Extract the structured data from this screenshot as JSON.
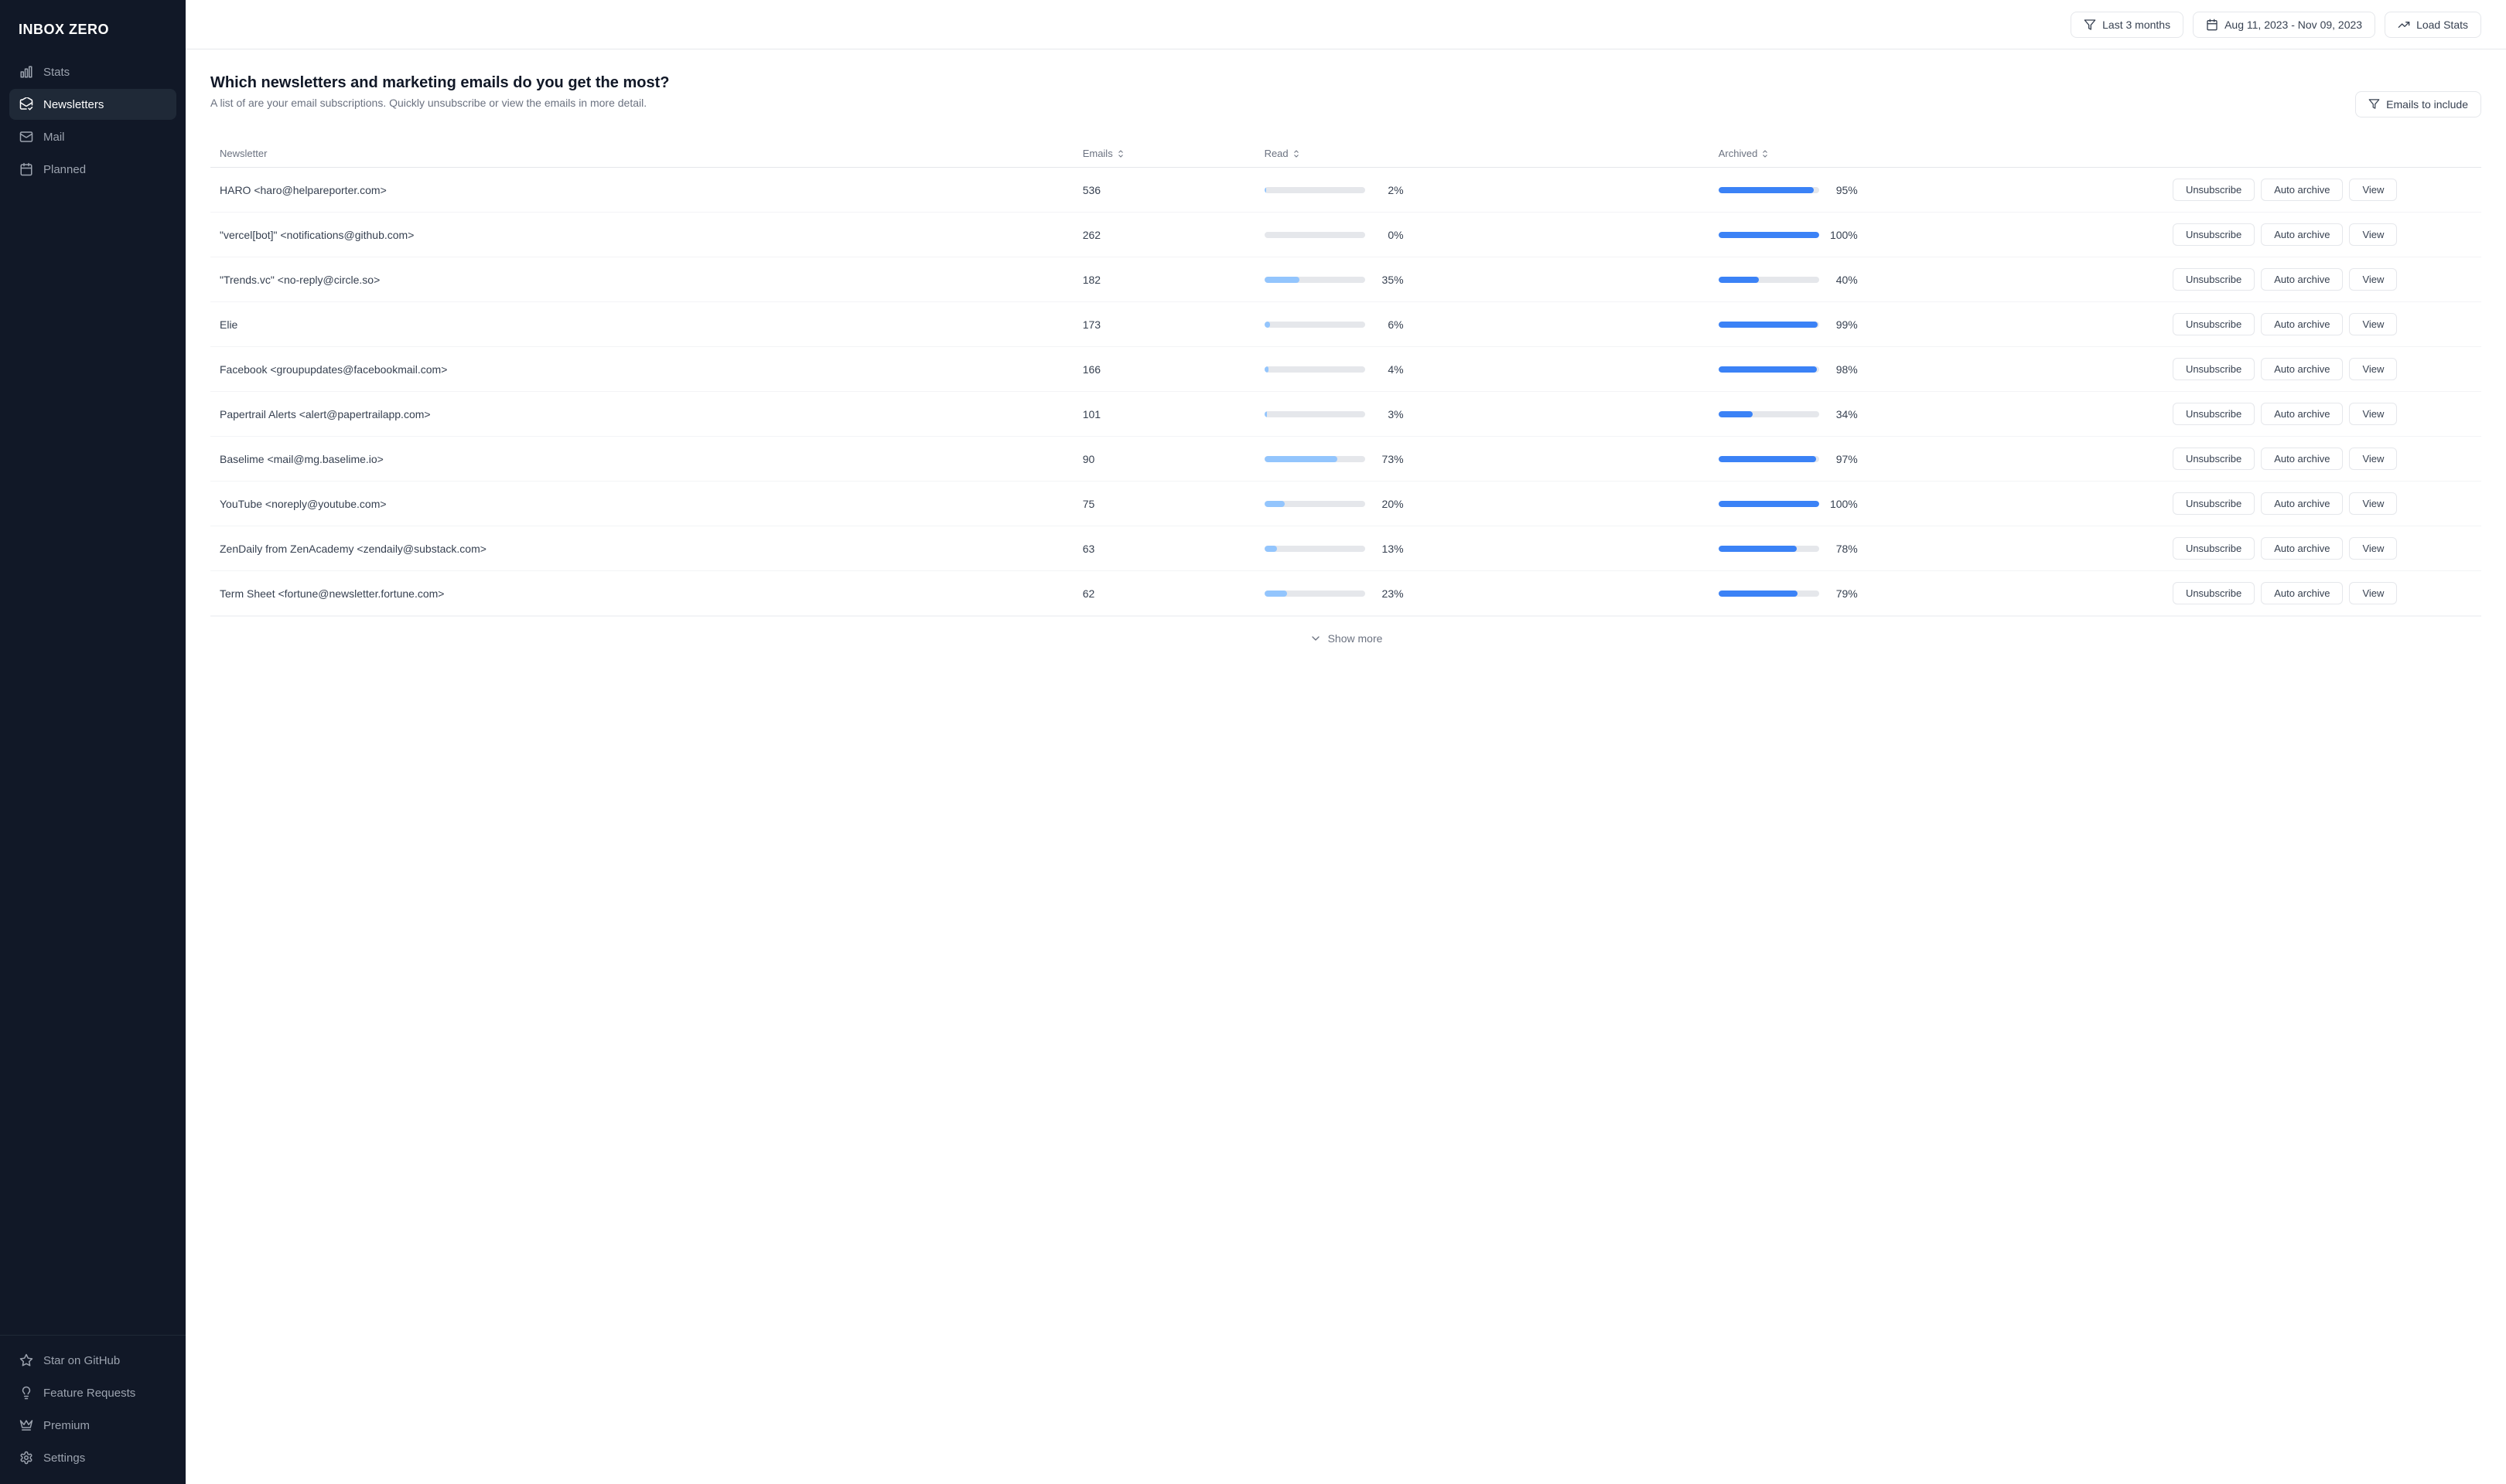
{
  "sidebar": {
    "logo": "INBOX ZERO",
    "items": [
      {
        "id": "stats",
        "label": "Stats",
        "icon": "bar-chart"
      },
      {
        "id": "newsletters",
        "label": "Newsletters",
        "icon": "mail-open",
        "active": true
      },
      {
        "id": "mail",
        "label": "Mail",
        "icon": "mail"
      },
      {
        "id": "planned",
        "label": "Planned",
        "icon": "calendar"
      }
    ],
    "bottom_items": [
      {
        "id": "star-github",
        "label": "Star on GitHub",
        "icon": "star"
      },
      {
        "id": "feature-requests",
        "label": "Feature Requests",
        "icon": "lightbulb"
      },
      {
        "id": "premium",
        "label": "Premium",
        "icon": "crown"
      },
      {
        "id": "settings",
        "label": "Settings",
        "icon": "gear"
      }
    ]
  },
  "header": {
    "period_label": "Last 3 months",
    "date_range": "Aug 11, 2023 - Nov 09, 2023",
    "load_stats_label": "Load Stats"
  },
  "page": {
    "title": "Which newsletters and marketing emails do you get the most?",
    "subtitle": "A list of are your email subscriptions. Quickly unsubscribe or view the emails in more detail.",
    "emails_to_include_label": "Emails to include"
  },
  "table": {
    "columns": [
      {
        "id": "newsletter",
        "label": "Newsletter"
      },
      {
        "id": "emails",
        "label": "Emails",
        "sortable": true
      },
      {
        "id": "read",
        "label": "Read",
        "sortable": true
      },
      {
        "id": "archived",
        "label": "Archived",
        "sortable": true
      }
    ],
    "rows": [
      {
        "name": "HARO <haro@helpareporter.com>",
        "emails": 536,
        "read_pct": 2,
        "archived_pct": 95,
        "actions": [
          "Unsubscribe",
          "Auto archive",
          "View"
        ]
      },
      {
        "name": "\"vercel[bot]\" <notifications@github.com>",
        "emails": 262,
        "read_pct": 0,
        "archived_pct": 100,
        "actions": [
          "Unsubscribe",
          "Auto archive",
          "View"
        ]
      },
      {
        "name": "\"Trends.vc\" <no-reply@circle.so>",
        "emails": 182,
        "read_pct": 35,
        "archived_pct": 40,
        "actions": [
          "Unsubscribe",
          "Auto archive",
          "View"
        ]
      },
      {
        "name": "Elie",
        "emails": 173,
        "read_pct": 6,
        "archived_pct": 99,
        "actions": [
          "Unsubscribe",
          "Auto archive",
          "View"
        ]
      },
      {
        "name": "Facebook <groupupdates@facebookmail.com>",
        "emails": 166,
        "read_pct": 4,
        "archived_pct": 98,
        "actions": [
          "Unsubscribe",
          "Auto archive",
          "View"
        ]
      },
      {
        "name": "Papertrail Alerts <alert@papertrailapp.com>",
        "emails": 101,
        "read_pct": 3,
        "archived_pct": 34,
        "actions": [
          "Unsubscribe",
          "Auto archive",
          "View"
        ]
      },
      {
        "name": "Baselime <mail@mg.baselime.io>",
        "emails": 90,
        "read_pct": 73,
        "archived_pct": 97,
        "actions": [
          "Unsubscribe",
          "Auto archive",
          "View"
        ]
      },
      {
        "name": "YouTube <noreply@youtube.com>",
        "emails": 75,
        "read_pct": 20,
        "archived_pct": 100,
        "actions": [
          "Unsubscribe",
          "Auto archive",
          "View"
        ]
      },
      {
        "name": "ZenDaily from ZenAcademy <zendaily@substack.com>",
        "emails": 63,
        "read_pct": 13,
        "archived_pct": 78,
        "actions": [
          "Unsubscribe",
          "Auto archive",
          "View"
        ]
      },
      {
        "name": "Term Sheet <fortune@newsletter.fortune.com>",
        "emails": 62,
        "read_pct": 23,
        "archived_pct": 79,
        "actions": [
          "Unsubscribe",
          "Auto archive",
          "View"
        ]
      }
    ],
    "show_more_label": "Show more"
  }
}
